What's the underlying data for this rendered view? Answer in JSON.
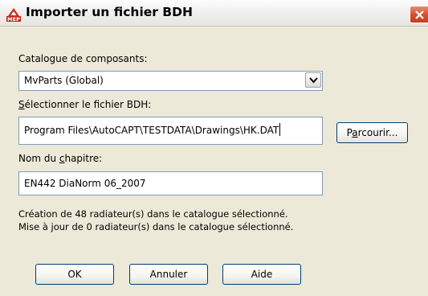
{
  "window": {
    "title": "Importer un fichier BDH",
    "icon": "mep-app-icon",
    "close_icon": "close-icon"
  },
  "catalog": {
    "label_pre": "Catalogue de composants:",
    "value": "MvParts (Global)"
  },
  "bdh": {
    "label_first": "S",
    "label_rest": "électionner le fichier BDH:",
    "value": "Program Files\\AutoCAPT\\TESTDATA\\Drawings\\HK.DAT",
    "browse_pre": "P",
    "browse_accel": "a",
    "browse_post": "rcourir..."
  },
  "chapter": {
    "label_pre": "Nom du ",
    "label_accel": "c",
    "label_post": "hapitre:",
    "value": "EN442 DiaNorm 06_2007"
  },
  "status": {
    "line1": "Création de 48 radiateur(s) dans le catalogue sélectionné.",
    "line2": "Mise à jour de 0 radiateur(s) dans le catalogue sélectionné."
  },
  "buttons": {
    "ok": "OK",
    "cancel": "Annuler",
    "help": "Aide"
  },
  "colors": {
    "dialog_bg": "#ece9d8",
    "field_border": "#7f9db9",
    "close_red": "#d5522f"
  }
}
